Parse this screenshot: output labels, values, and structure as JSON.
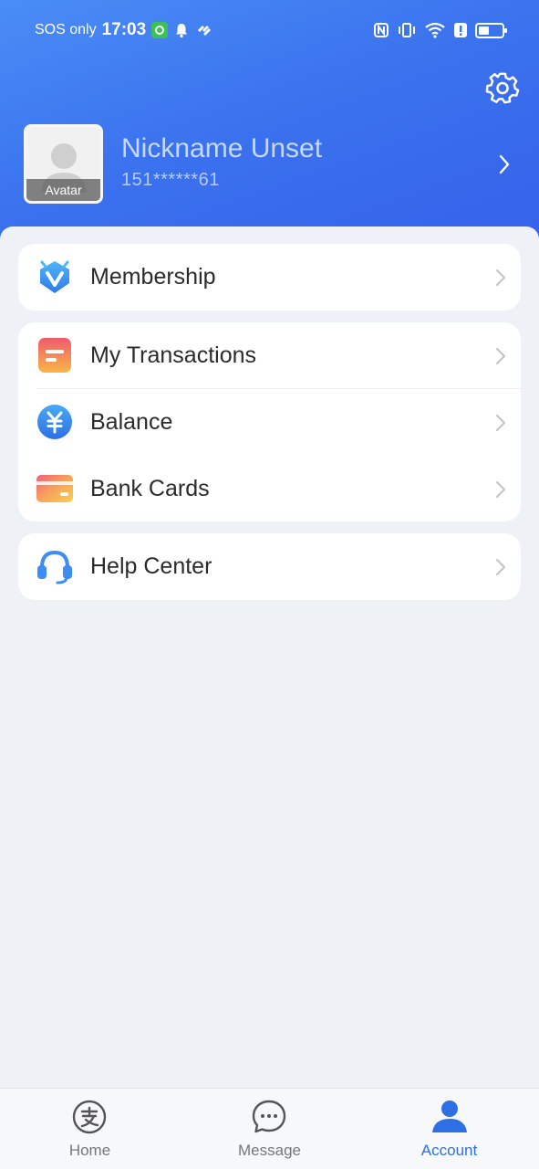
{
  "status_bar": {
    "carrier": "SOS only",
    "time": "17:03"
  },
  "profile": {
    "avatar_label": "Avatar",
    "nickname": "Nickname Unset",
    "phone": "151******61"
  },
  "menu": {
    "membership": "Membership",
    "transactions": "My Transactions",
    "balance": "Balance",
    "bank_cards": "Bank Cards",
    "help_center": "Help Center"
  },
  "tabs": {
    "home": "Home",
    "message": "Message",
    "account": "Account"
  },
  "colors": {
    "header": "#3b72ee",
    "accent": "#2f6fe4",
    "background": "#eef2f6"
  }
}
